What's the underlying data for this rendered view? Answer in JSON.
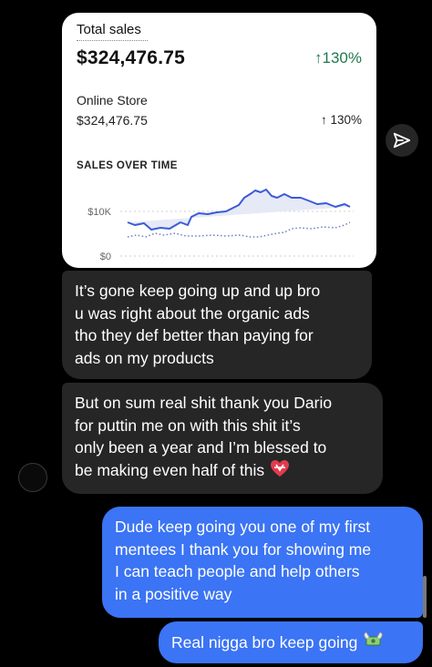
{
  "card": {
    "total_label": "Total sales",
    "total_amount": "$324,476.75",
    "total_change": "↑130%",
    "store_label": "Online Store",
    "store_amount": "$324,476.75",
    "store_change": "↑ 130%",
    "chart_title": "SALES OVER TIME",
    "y_ticks": [
      "$10K",
      "$0"
    ]
  },
  "messages": {
    "m1": [
      "It’s gone keep going up and up bro",
      "u was right about the organic ads",
      "tho they def better than paying for",
      "ads on my products"
    ],
    "m2": [
      "But on sum real shit thank you Dario",
      "for puttin me on with this shit it’s",
      "only been a year and I’m blessed to",
      "be making even half of this"
    ],
    "m3": [
      "Dude keep going you one of my first",
      "mentees I thank you for showing me",
      "I can teach people and help others",
      "in a positive way"
    ],
    "m4": "Real nigga bro keep going"
  },
  "icons": {
    "send": "send-arrow-icon",
    "heart": "heart-with-ribbon-emoji",
    "money": "money-with-wings-emoji"
  },
  "colors": {
    "outgoing_bubble": "#3b74f4",
    "incoming_bubble": "#262626",
    "positive_change": "#1f7a4d"
  }
}
